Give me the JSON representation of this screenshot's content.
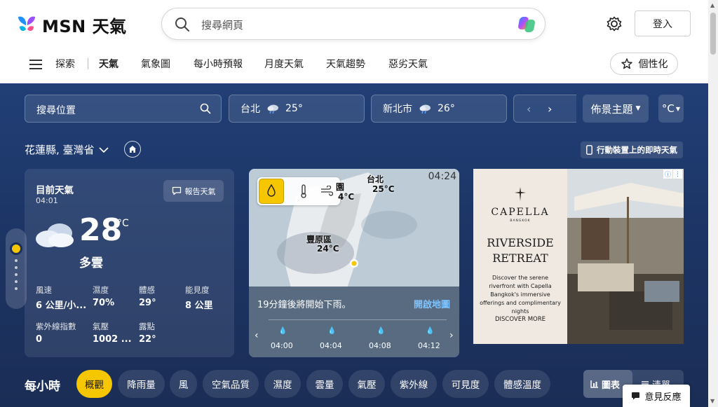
{
  "header": {
    "brand": "MSN 天氣",
    "search_placeholder": "搜尋網頁",
    "login_label": "登入"
  },
  "nav": {
    "explore": "探索",
    "items": [
      "天氣",
      "氣象圖",
      "每小時預報",
      "月度天氣",
      "天氣趨勢",
      "惡劣天氣"
    ],
    "personalize": "個性化"
  },
  "toolbar": {
    "location_placeholder": "搜尋位置",
    "cities": [
      {
        "name": "台北",
        "temp": "25°"
      },
      {
        "name": "新北市",
        "temp": "26°"
      }
    ],
    "theme_label": "佈景主題",
    "unit_label": "°C"
  },
  "location": {
    "name": "花蓮縣, 臺灣省",
    "mobile_label": "行動裝置上的即時天氣"
  },
  "current": {
    "title": "目前天氣",
    "time": "04:01",
    "report_label": "報告天氣",
    "temp": "28",
    "unit": "°C",
    "condition": "多雲",
    "stats": [
      {
        "label": "風速",
        "value": "6 公里/小..."
      },
      {
        "label": "濕度",
        "value": "70%"
      },
      {
        "label": "體感",
        "value": "29°"
      },
      {
        "label": "能見度",
        "value": "8 公里"
      },
      {
        "label": "紫外線指數",
        "value": "0"
      },
      {
        "label": "氣壓",
        "value": "1002 ..."
      },
      {
        "label": "露點",
        "value": "22°"
      }
    ]
  },
  "map": {
    "time": "04:24",
    "labels": [
      {
        "name": "台北",
        "temp": "25°C"
      },
      {
        "name": "豐原區",
        "temp": "24°C"
      },
      {
        "name": "園",
        "temp": "4°C"
      }
    ],
    "message": "19分鐘後將開始下雨。",
    "open_label": "開啟地圖",
    "timeline": [
      "04:00",
      "04:04",
      "04:08",
      "04:12"
    ]
  },
  "ad": {
    "brand": "CAPELLA",
    "sub": "BANGKOK",
    "headline_1": "RIVERSIDE",
    "headline_2": "RETREAT",
    "body": "Discover the serene riverfront with Capella Bangkok's immersive offerings and complimentary nights",
    "cta": "DISCOVER MORE"
  },
  "hourly": {
    "title": "每小時",
    "tabs": [
      "概觀",
      "降雨量",
      "風",
      "空氣品質",
      "濕度",
      "雲量",
      "氣壓",
      "紫外線",
      "可見度",
      "體感溫度"
    ],
    "view_chart": "圖表",
    "view_list": "清單"
  },
  "feedback_label": "意見反應",
  "colors": {
    "accent_yellow": "#f6c600",
    "main_bg": "#1d3667",
    "link_blue": "#7fc4ff"
  }
}
